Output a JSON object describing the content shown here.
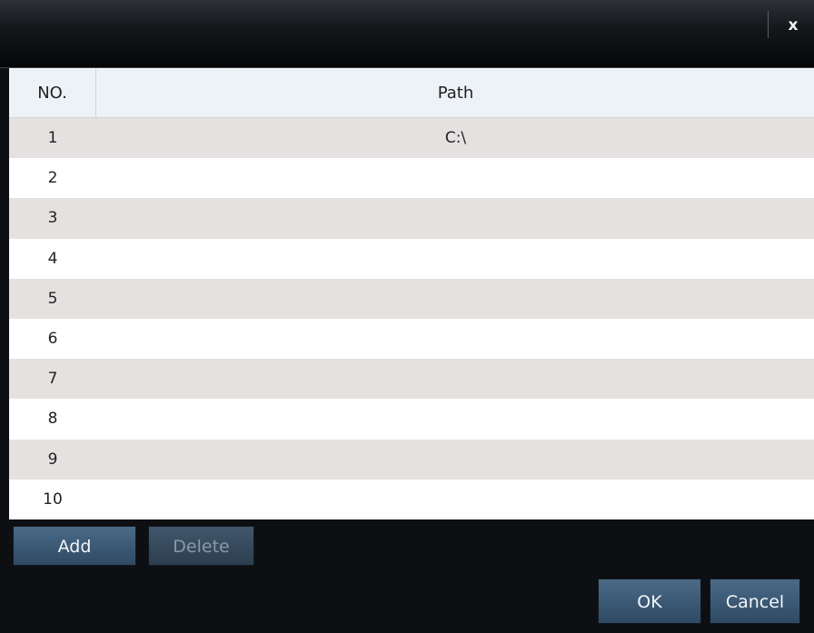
{
  "titlebar": {
    "close_label": "x"
  },
  "table": {
    "headers": {
      "no": "NO.",
      "path": "Path"
    },
    "rows": [
      {
        "no": "1",
        "path": "C:\\"
      },
      {
        "no": "2",
        "path": ""
      },
      {
        "no": "3",
        "path": ""
      },
      {
        "no": "4",
        "path": ""
      },
      {
        "no": "5",
        "path": ""
      },
      {
        "no": "6",
        "path": ""
      },
      {
        "no": "7",
        "path": ""
      },
      {
        "no": "8",
        "path": ""
      },
      {
        "no": "9",
        "path": ""
      },
      {
        "no": "10",
        "path": ""
      }
    ]
  },
  "buttons": {
    "add": "Add",
    "delete": "Delete",
    "ok": "OK",
    "cancel": "Cancel"
  },
  "colors": {
    "titlebar": "#050607",
    "row_stripe": "#e6e1e1",
    "button": "#3a5670"
  }
}
